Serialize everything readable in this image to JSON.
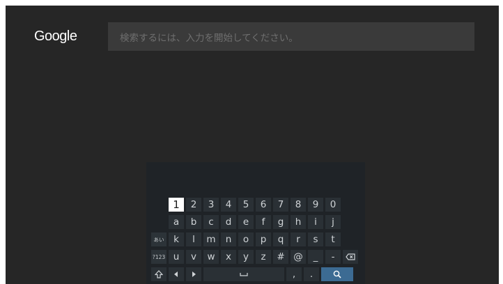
{
  "header": {
    "logo": "Google",
    "search_placeholder": "検索するには、入力を開始してください。"
  },
  "keyboard": {
    "row_numbers": [
      "1",
      "2",
      "3",
      "4",
      "5",
      "6",
      "7",
      "8",
      "9",
      "0"
    ],
    "row_1": [
      "a",
      "b",
      "c",
      "d",
      "e",
      "f",
      "g",
      "h",
      "i",
      "j"
    ],
    "row_2_mode": "あい",
    "row_2": [
      "k",
      "l",
      "m",
      "n",
      "o",
      "p",
      "q",
      "r",
      "s",
      "t"
    ],
    "row_3_mode": "?123",
    "row_3": [
      "u",
      "v",
      "w",
      "x",
      "y",
      "z",
      "#",
      "@",
      "_",
      "-"
    ],
    "selected_key": "1",
    "icons": {
      "backspace": "backspace-icon",
      "shift": "shift-icon",
      "left": "arrow-left-icon",
      "right": "arrow-right-icon",
      "space": "space-icon",
      "search": "search-icon"
    },
    "row_4_punct": [
      ",",
      "."
    ],
    "accent_color": "#3c6b93"
  }
}
